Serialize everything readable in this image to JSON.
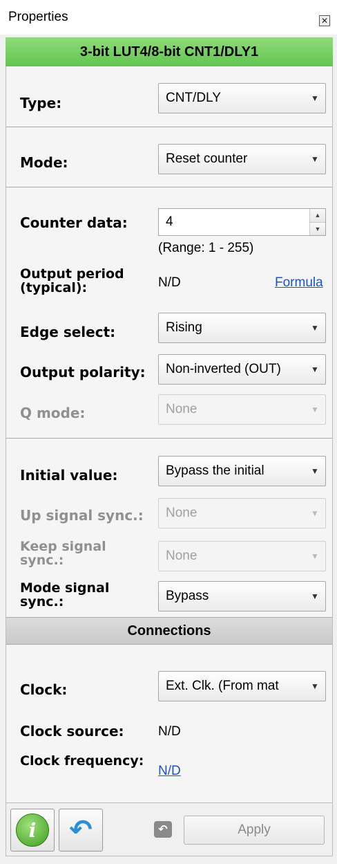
{
  "window": {
    "title": "Properties",
    "close_glyph": "✕"
  },
  "header": {
    "title": "3-bit LUT4/8-bit CNT1/DLY1"
  },
  "type": {
    "label": "Type:",
    "value": "CNT/DLY"
  },
  "mode": {
    "label": "Mode:",
    "value": "Reset counter"
  },
  "counter_data": {
    "label": "Counter data:",
    "value": "4",
    "range": "(Range:  1 - 255)"
  },
  "output_period": {
    "label": "Output period (typical):",
    "value": "N/D",
    "formula_link": "Formula"
  },
  "edge_select": {
    "label": "Edge select:",
    "value": "Rising"
  },
  "output_polarity": {
    "label": "Output polarity:",
    "value": "Non-inverted (OUT)"
  },
  "q_mode": {
    "label": "Q mode:",
    "value": "None"
  },
  "initial_value": {
    "label": "Initial value:",
    "value": "Bypass the initial"
  },
  "up_signal_sync": {
    "label": "Up signal sync.:",
    "value": "None"
  },
  "keep_signal_sync": {
    "label": "Keep signal sync.:",
    "value": "None"
  },
  "mode_signal_sync": {
    "label": "Mode signal sync.:",
    "value": "Bypass"
  },
  "connections": {
    "title": "Connections"
  },
  "clock": {
    "label": "Clock:",
    "value": "Ext. Clk. (From mat"
  },
  "clock_source": {
    "label": "Clock source:",
    "value": "N/D"
  },
  "clock_frequency": {
    "label": "Clock frequency:",
    "value": "N/D"
  },
  "footer": {
    "apply_label": "Apply",
    "info_glyph": "i",
    "undo_glyph": "↶",
    "small_undo_glyph": "↶"
  },
  "icons": [
    "close-icon",
    "dropdown-arrow-icon",
    "spin-up-icon",
    "spin-down-icon",
    "info-icon",
    "undo-icon"
  ],
  "colors": {
    "header_green": "#63c450",
    "link_blue": "#1a55c8"
  }
}
